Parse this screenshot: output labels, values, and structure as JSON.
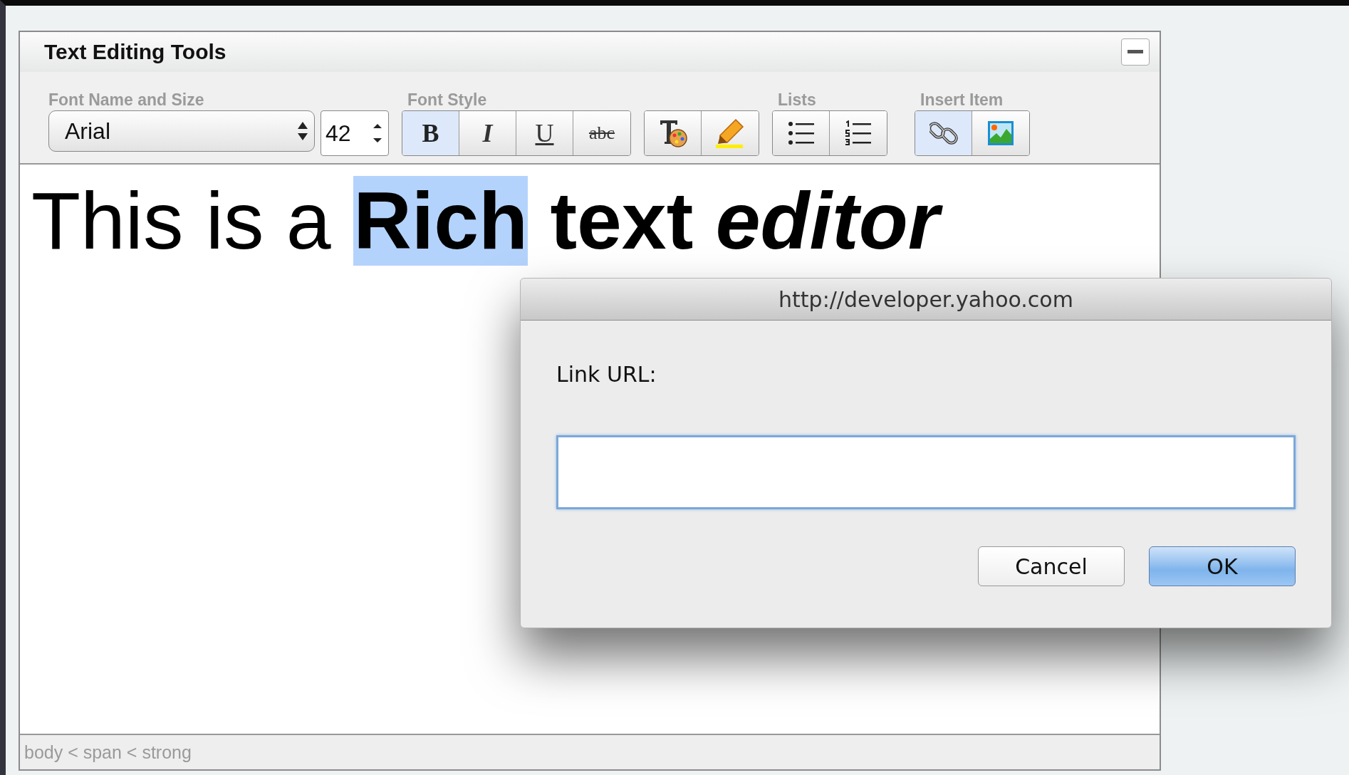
{
  "panel": {
    "title": "Text Editing Tools"
  },
  "toolbar": {
    "groups": [
      {
        "kind": "font",
        "label": "Font Name and Size",
        "font_name": "Arial",
        "font_size": "42"
      },
      {
        "kind": "buttons",
        "label": "Font Style",
        "buttons": [
          {
            "kind": "bold",
            "label": "B",
            "selected": true
          },
          {
            "kind": "italic",
            "label": "I",
            "selected": false
          },
          {
            "kind": "underline",
            "label": "U",
            "selected": false
          },
          {
            "kind": "strike",
            "label": "abc",
            "selected": false
          }
        ]
      },
      {
        "kind": "buttons",
        "buttons": [
          {
            "kind": "textcolor",
            "selected": false
          },
          {
            "kind": "highlight",
            "selected": false
          }
        ]
      },
      {
        "kind": "buttons",
        "label": "Lists",
        "buttons": [
          {
            "kind": "bullets",
            "selected": false
          },
          {
            "kind": "numbers",
            "selected": false
          }
        ]
      },
      {
        "kind": "buttons",
        "label": "Insert Item",
        "buttons": [
          {
            "kind": "link",
            "selected": true
          },
          {
            "kind": "image",
            "selected": false
          }
        ]
      }
    ]
  },
  "content": {
    "segments": [
      {
        "text": "This is a ",
        "kind": "plain",
        "selected": false
      },
      {
        "text": "Rich",
        "kind": "bold",
        "selected": true
      },
      {
        "text": " text ",
        "kind": "bold",
        "selected": false
      },
      {
        "text": "editor",
        "kind": "bolditalic",
        "selected": false
      }
    ]
  },
  "status_bar": "body < span < strong",
  "dialog": {
    "title": "http://developer.yahoo.com",
    "label": "Link URL:",
    "buttons": [
      {
        "label": "Cancel",
        "default": false
      },
      {
        "label": "OK",
        "default": true
      }
    ]
  }
}
